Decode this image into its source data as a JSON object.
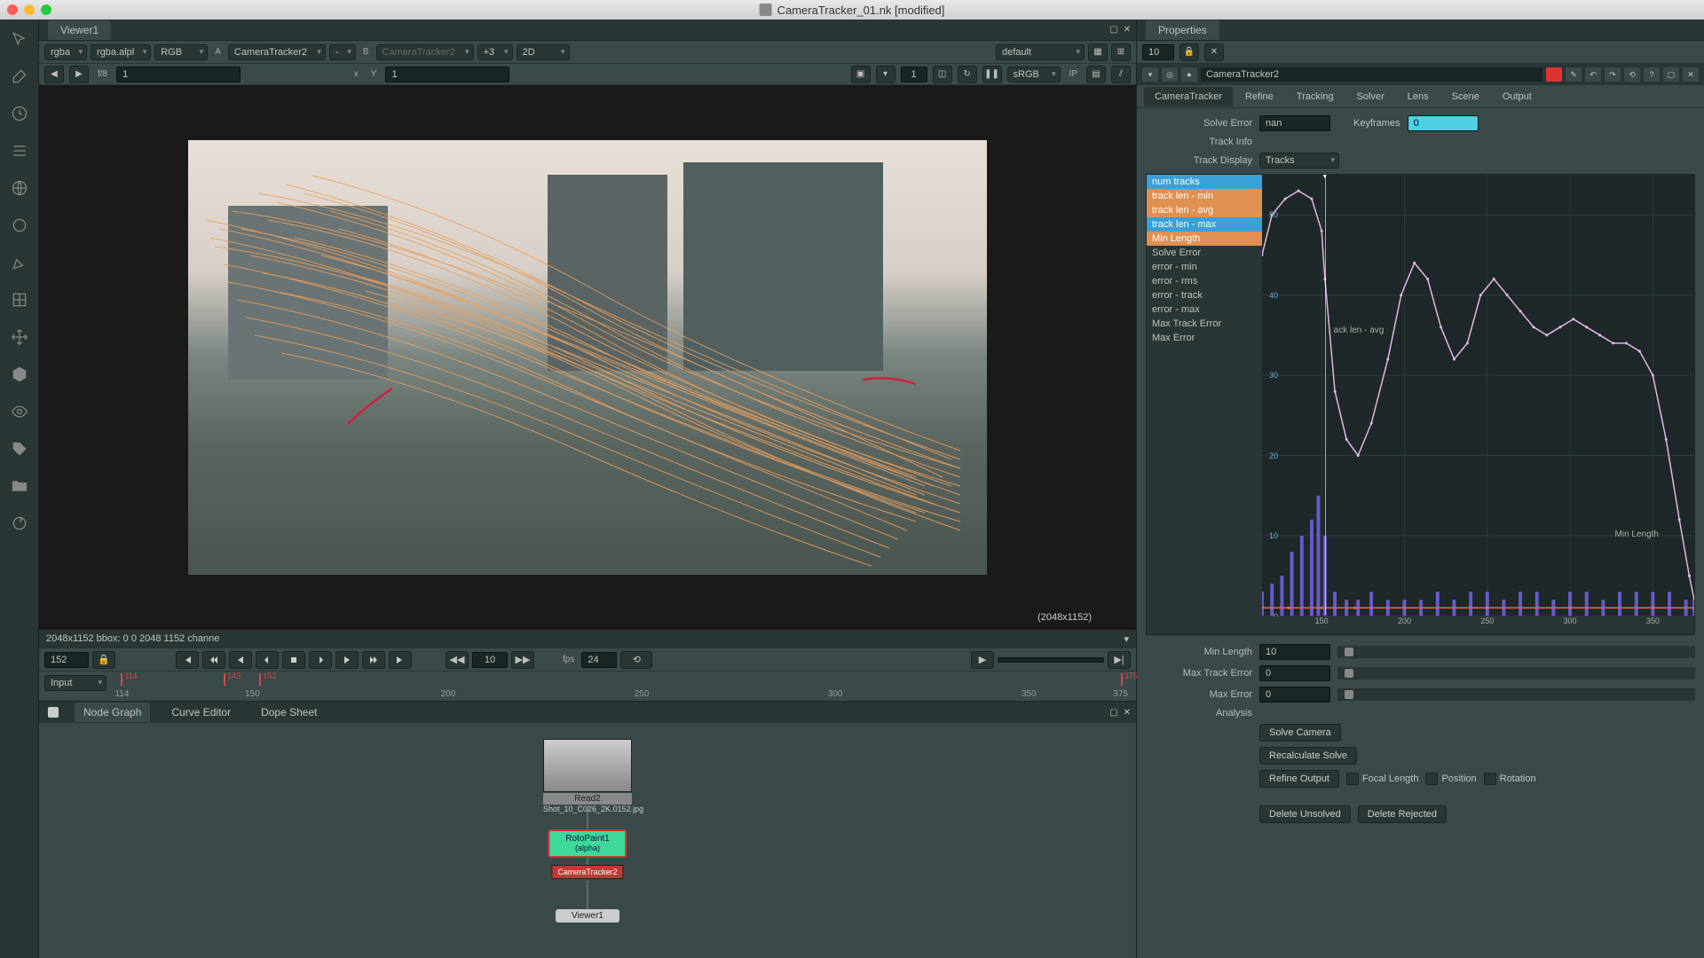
{
  "window": {
    "title": "CameraTracker_01.nk [modified]"
  },
  "panels": {
    "viewer": "Viewer1",
    "properties": "Properties"
  },
  "viewer_toolbar": {
    "channel": "rgba",
    "alpha": "rgba.alpl",
    "colorspace": "RGB",
    "input_a_label": "A",
    "input_a": "CameraTracker2",
    "dash": "-",
    "input_b_label": "B",
    "input_b": "CameraTracker2",
    "gain": "+3",
    "view_mode": "2D",
    "default": "default"
  },
  "viewer_toolbar2": {
    "f_label": "f/8",
    "frame": "1",
    "x_label": "x",
    "x_val": "",
    "y_label": "Y",
    "y_val": "1",
    "lut": "sRGB",
    "ip": "IP"
  },
  "viewer": {
    "resolution": "(2048x1152)",
    "status": "2048x1152 bbox: 0 0 2048 1152 channe"
  },
  "playback": {
    "current_frame": "152",
    "step": "10",
    "fps_label": "fps",
    "fps": "24",
    "input": "Input"
  },
  "timeline": {
    "ticks": [
      "114",
      "150",
      "200",
      "250",
      "300",
      "350",
      "375"
    ],
    "markers": {
      "start": "114",
      "m1": "143",
      "cur": "152",
      "end": "375"
    }
  },
  "bottom_tabs": {
    "node_graph": "Node Graph",
    "curve_editor": "Curve Editor",
    "dope_sheet": "Dope Sheet"
  },
  "nodes": {
    "read_name": "Read2",
    "read_file": "Shot_10_C026_2K.0152.jpg",
    "roto_name": "RotoPaint1",
    "roto_sub": "(alpha)",
    "ct_name": "CameraTracker2",
    "viewer_name": "Viewer1"
  },
  "properties": {
    "panel_count": "10",
    "node_name": "CameraTracker2",
    "tabs": [
      "CameraTracker",
      "Refine",
      "Tracking",
      "Solver",
      "Lens",
      "Scene",
      "Output"
    ],
    "solve_error_label": "Solve Error",
    "solve_error": "nan",
    "keyframes_label": "Keyframes",
    "keyframes": "0",
    "track_info_label": "Track Info",
    "track_display_label": "Track Display",
    "track_display": "Tracks",
    "legend": [
      "num tracks",
      "track len - min",
      "track len - avg",
      "track len - max",
      "Min Length",
      "Solve Error",
      "error - min",
      "error - rms",
      "error - track",
      "error - max",
      "Max Track Error",
      "Max Error"
    ],
    "legend_selected": [
      0,
      1,
      2,
      3,
      4
    ],
    "min_length_label": "Min Length",
    "min_length": "10",
    "max_track_error_label": "Max Track Error",
    "max_track_error": "0",
    "max_error_label": "Max Error",
    "max_error": "0",
    "analysis_label": "Analysis",
    "solve_camera": "Solve Camera",
    "recalculate_solve": "Recalculate Solve",
    "refine_output": "Refine Output",
    "focal_length": "Focal Length",
    "position": "Position",
    "rotation": "Rotation",
    "delete_unsolved": "Delete Unsolved",
    "delete_rejected": "Delete Rejected",
    "graph_min_length_label": "Min Length",
    "graph_avg_label": "ack len - avg"
  },
  "chart_data": {
    "type": "line",
    "x_range": [
      114,
      375
    ],
    "x_ticks": [
      150,
      200,
      250,
      300,
      350
    ],
    "y_range": [
      0,
      55
    ],
    "y_ticks": [
      0,
      10,
      20,
      30,
      40,
      50
    ],
    "cursor_x": 152,
    "series": [
      {
        "name": "track len - avg",
        "color": "#e8b8e8",
        "points": [
          [
            114,
            45
          ],
          [
            120,
            50
          ],
          [
            128,
            52
          ],
          [
            136,
            53
          ],
          [
            144,
            52
          ],
          [
            150,
            48
          ],
          [
            152,
            42
          ],
          [
            158,
            28
          ],
          [
            165,
            22
          ],
          [
            172,
            20
          ],
          [
            180,
            24
          ],
          [
            190,
            32
          ],
          [
            198,
            40
          ],
          [
            206,
            44
          ],
          [
            214,
            42
          ],
          [
            222,
            36
          ],
          [
            230,
            32
          ],
          [
            238,
            34
          ],
          [
            246,
            40
          ],
          [
            254,
            42
          ],
          [
            262,
            40
          ],
          [
            270,
            38
          ],
          [
            278,
            36
          ],
          [
            286,
            35
          ],
          [
            294,
            36
          ],
          [
            302,
            37
          ],
          [
            310,
            36
          ],
          [
            318,
            35
          ],
          [
            326,
            34
          ],
          [
            334,
            34
          ],
          [
            342,
            33
          ],
          [
            350,
            30
          ],
          [
            358,
            22
          ],
          [
            366,
            12
          ],
          [
            372,
            5
          ],
          [
            375,
            2
          ]
        ]
      },
      {
        "name": "Min Length",
        "color": "#6a5acd",
        "style": "bar",
        "points": [
          [
            114,
            3
          ],
          [
            120,
            4
          ],
          [
            126,
            5
          ],
          [
            132,
            8
          ],
          [
            138,
            10
          ],
          [
            144,
            12
          ],
          [
            148,
            15
          ],
          [
            152,
            10
          ],
          [
            158,
            3
          ],
          [
            165,
            2
          ],
          [
            172,
            2
          ],
          [
            180,
            3
          ],
          [
            190,
            2
          ],
          [
            200,
            2
          ],
          [
            210,
            2
          ],
          [
            220,
            3
          ],
          [
            230,
            2
          ],
          [
            240,
            3
          ],
          [
            250,
            3
          ],
          [
            260,
            2
          ],
          [
            270,
            3
          ],
          [
            280,
            3
          ],
          [
            290,
            2
          ],
          [
            300,
            3
          ],
          [
            310,
            3
          ],
          [
            320,
            2
          ],
          [
            330,
            3
          ],
          [
            340,
            3
          ],
          [
            350,
            3
          ],
          [
            360,
            3
          ],
          [
            370,
            2
          ],
          [
            375,
            2
          ]
        ]
      },
      {
        "name": "track len - min",
        "color": "#d87050",
        "points": [
          [
            114,
            1
          ],
          [
            130,
            1
          ],
          [
            150,
            1
          ],
          [
            170,
            1
          ],
          [
            200,
            1
          ],
          [
            250,
            1
          ],
          [
            300,
            1
          ],
          [
            350,
            1
          ],
          [
            375,
            1
          ]
        ]
      }
    ]
  }
}
